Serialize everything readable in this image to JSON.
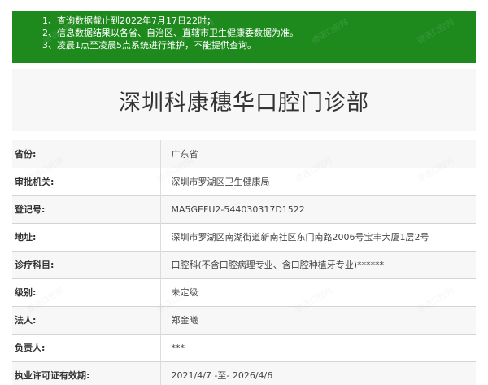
{
  "notice": {
    "lines": [
      "1、查询数据截止到2022年7月17日22时；",
      "2、信息数据结果以各省、自治区、直辖市卫生健康委数据为准。",
      "3、凌晨1点至凌晨5点系统进行维护，不能提供查询。"
    ]
  },
  "title": "深圳科康穗华口腔门诊部",
  "rows": [
    {
      "key": "省份:",
      "value": "广东省"
    },
    {
      "key": "审批机关:",
      "value": "深圳市罗湖区卫生健康局"
    },
    {
      "key": "登记号:",
      "value": "MA5GEFU2-544030317D1522"
    },
    {
      "key": "地址:",
      "value": "深圳市罗湖区南湖街道新南社区东门南路2006号宝丰大厦1层2号"
    },
    {
      "key": "诊疗科目:",
      "value": "口腔科(不含口腔病理专业、含口腔种植牙专业)******"
    },
    {
      "key": "级别:",
      "value": "未定级"
    },
    {
      "key": "法人:",
      "value": "郑金曦"
    },
    {
      "key": "负责人:",
      "value": "***"
    },
    {
      "key": "执业许可证有效期:",
      "value": "2021/4/7 -至- 2026/4/6"
    }
  ],
  "watermark": "德语口腔网"
}
